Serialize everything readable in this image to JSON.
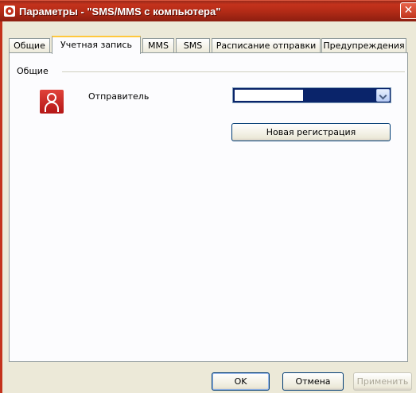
{
  "window": {
    "title": "Параметры - \"SMS/MMS с компьютера\"",
    "close_glyph": "✕"
  },
  "tabs": [
    {
      "label": "Общие"
    },
    {
      "label": "Учетная запись",
      "active": true
    },
    {
      "label": "MMS"
    },
    {
      "label": "SMS"
    },
    {
      "label": "Расписание отправки"
    },
    {
      "label": "Предупреждения"
    }
  ],
  "account": {
    "group_label": "Общие",
    "sender_label": "Отправитель",
    "sender_value": "",
    "register_button": "Новая регистрация"
  },
  "footer": {
    "ok": "OK",
    "cancel": "Отмена",
    "apply": "Применить"
  },
  "colors": {
    "titlebar": "#c4321c",
    "tab_active_accent": "#ffc83c",
    "combo_selection": "#0a246a"
  },
  "icons": {
    "app": "app-icon",
    "user": "user-icon",
    "close": "close-icon",
    "dropdown": "chevron-down-icon"
  }
}
